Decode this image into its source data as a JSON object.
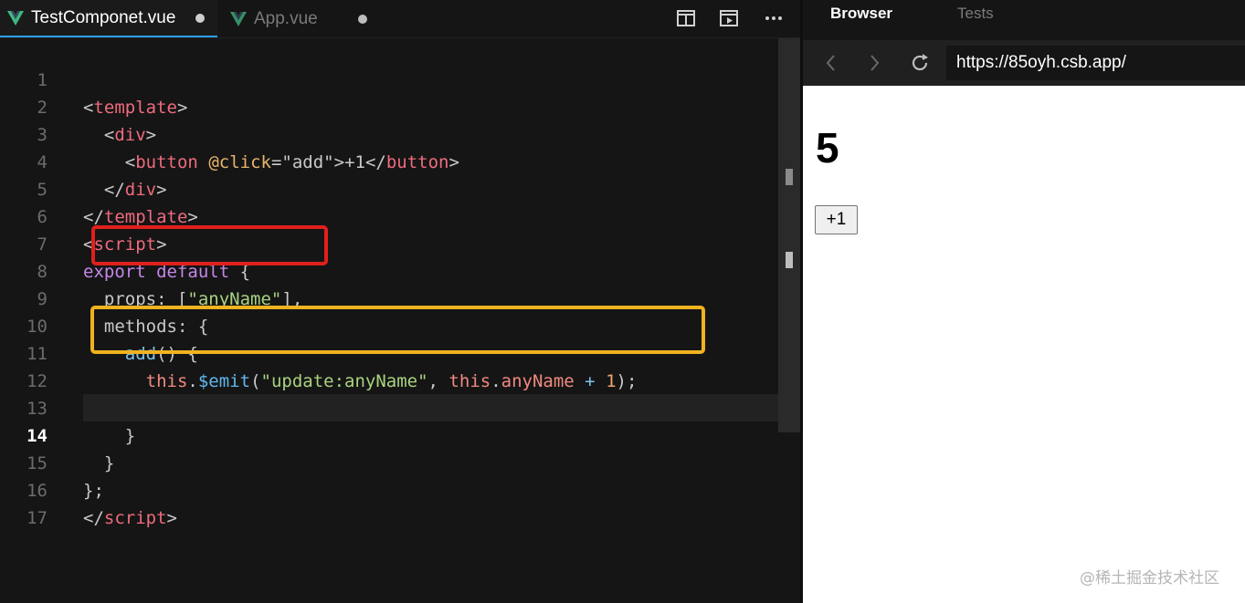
{
  "editor": {
    "tabs": [
      {
        "label": "TestComponet.vue",
        "active": true,
        "unsaved": true
      },
      {
        "label": "App.vue",
        "active": false,
        "unsaved": true
      }
    ],
    "toolbar": {
      "split_icon": "split-editor-icon",
      "preview_icon": "open-preview-icon",
      "more_icon": "more-actions-icon"
    },
    "current_line": 14,
    "lines": [
      {
        "n": "1"
      },
      {
        "n": "2"
      },
      {
        "n": "3"
      },
      {
        "n": "4"
      },
      {
        "n": "5"
      },
      {
        "n": "6"
      },
      {
        "n": "7"
      },
      {
        "n": "8"
      },
      {
        "n": "9"
      },
      {
        "n": "10"
      },
      {
        "n": "11"
      },
      {
        "n": "12"
      },
      {
        "n": "13"
      },
      {
        "n": "14"
      },
      {
        "n": "15"
      },
      {
        "n": "16"
      },
      {
        "n": "17"
      }
    ],
    "code": {
      "l1": {
        "a": "<",
        "b": "template",
        "c": ">"
      },
      "l2": {
        "indent": "  ",
        "a": "<",
        "b": "div",
        "c": ">"
      },
      "l3": {
        "indent": "    ",
        "a": "<",
        "b": "button",
        "sp": " ",
        "attr": "@click",
        "eq": "=",
        "str": "\"add\"",
        "gt": ">",
        "txt": "+1",
        "close": "</",
        "tag2": "button",
        "end": ">"
      },
      "l4": {
        "indent": "  ",
        "a": "</",
        "b": "div",
        "c": ">"
      },
      "l5": {
        "a": "</",
        "b": "template",
        "c": ">"
      },
      "l6": {
        "a": "<",
        "b": "script",
        "c": ">"
      },
      "l7": {
        "kw1": "export",
        "sp": " ",
        "kw2": "default",
        "rest": " {"
      },
      "l8": {
        "indent": "  ",
        "prop": "props",
        "colon": ": [",
        "str": "\"anyName\"",
        "end": "],"
      },
      "l9": {
        "indent": "  ",
        "prop": "methods",
        "rest": ": {"
      },
      "l10": {
        "indent": "    ",
        "fn": "add",
        "rest": "() {"
      },
      "l11": {
        "indent": "      ",
        "this1": "this",
        "dot1": ".",
        "emit": "$emit",
        "p1": "(",
        "str": "\"update:anyName\"",
        "comma": ", ",
        "this2": "this",
        "dot2": ".",
        "prop": "anyName",
        "plus": " + ",
        "num": "1",
        "end": ");"
      },
      "l12": {
        "text": ""
      },
      "l13": {
        "indent": "    ",
        "text": "}"
      },
      "l14": {
        "indent": "  ",
        "text": "}"
      },
      "l15": {
        "text": "};"
      },
      "l16": {
        "a": "</",
        "b": "script",
        "c": ">"
      },
      "l17": {
        "text": ""
      }
    },
    "annotations": {
      "red_box_color": "#e0201c",
      "orange_box_color": "#f0b21f"
    }
  },
  "browser": {
    "tabs": [
      {
        "label": "Browser",
        "active": true
      },
      {
        "label": "Tests",
        "active": false
      }
    ],
    "url": "https://85oyh.csb.app/",
    "content": {
      "value": "5",
      "button_label": "+1"
    },
    "watermark": "@稀土掘金技术社区"
  }
}
